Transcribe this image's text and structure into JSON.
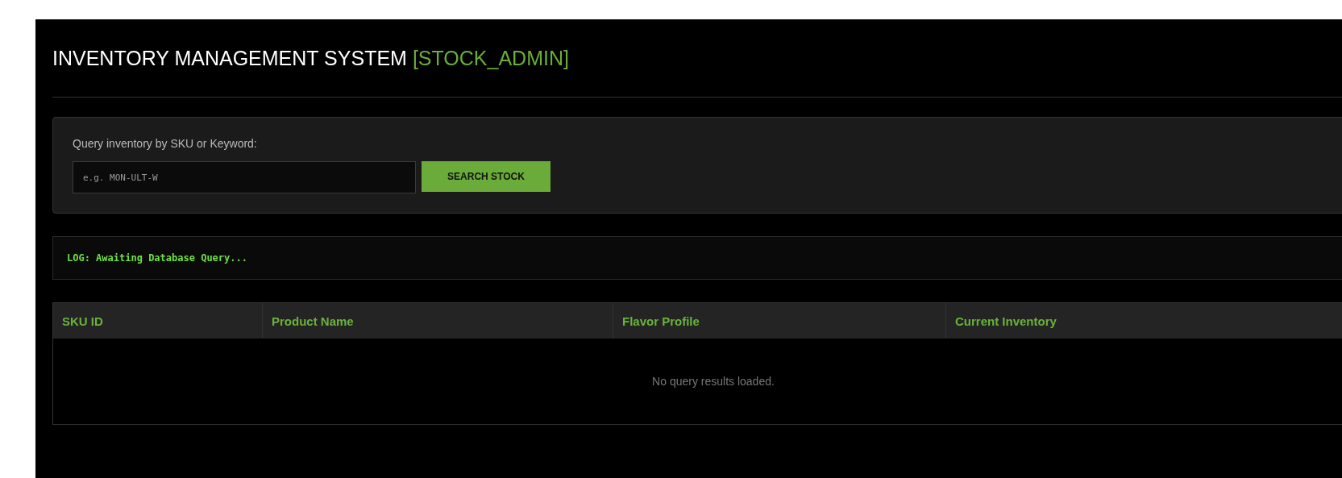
{
  "header": {
    "title": "INVENTORY MANAGEMENT SYSTEM",
    "role": "[STOCK_ADMIN]"
  },
  "search": {
    "label": "Query inventory by SKU or Keyword:",
    "placeholder": "e.g. MON-ULT-W",
    "button": "SEARCH STOCK"
  },
  "log": {
    "text": "LOG: Awaiting Database Query..."
  },
  "table": {
    "columns": [
      "SKU ID",
      "Product Name",
      "Flavor Profile",
      "Current Inventory"
    ],
    "empty_message": "No query results loaded."
  }
}
